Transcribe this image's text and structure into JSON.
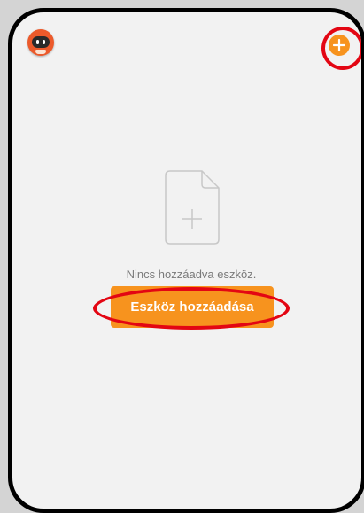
{
  "header": {
    "avatar_icon": "robot-avatar-icon",
    "add_icon": "plus-circle-icon"
  },
  "empty_state": {
    "icon": "add-document-icon",
    "message": "Nincs hozzáadva eszköz.",
    "button_label": "Eszköz hozzáadása"
  },
  "annotations": {
    "highlight_color": "#e30613"
  },
  "colors": {
    "accent": "#f7931e",
    "background": "#f2f2f2",
    "text_muted": "#7a7a7a"
  }
}
